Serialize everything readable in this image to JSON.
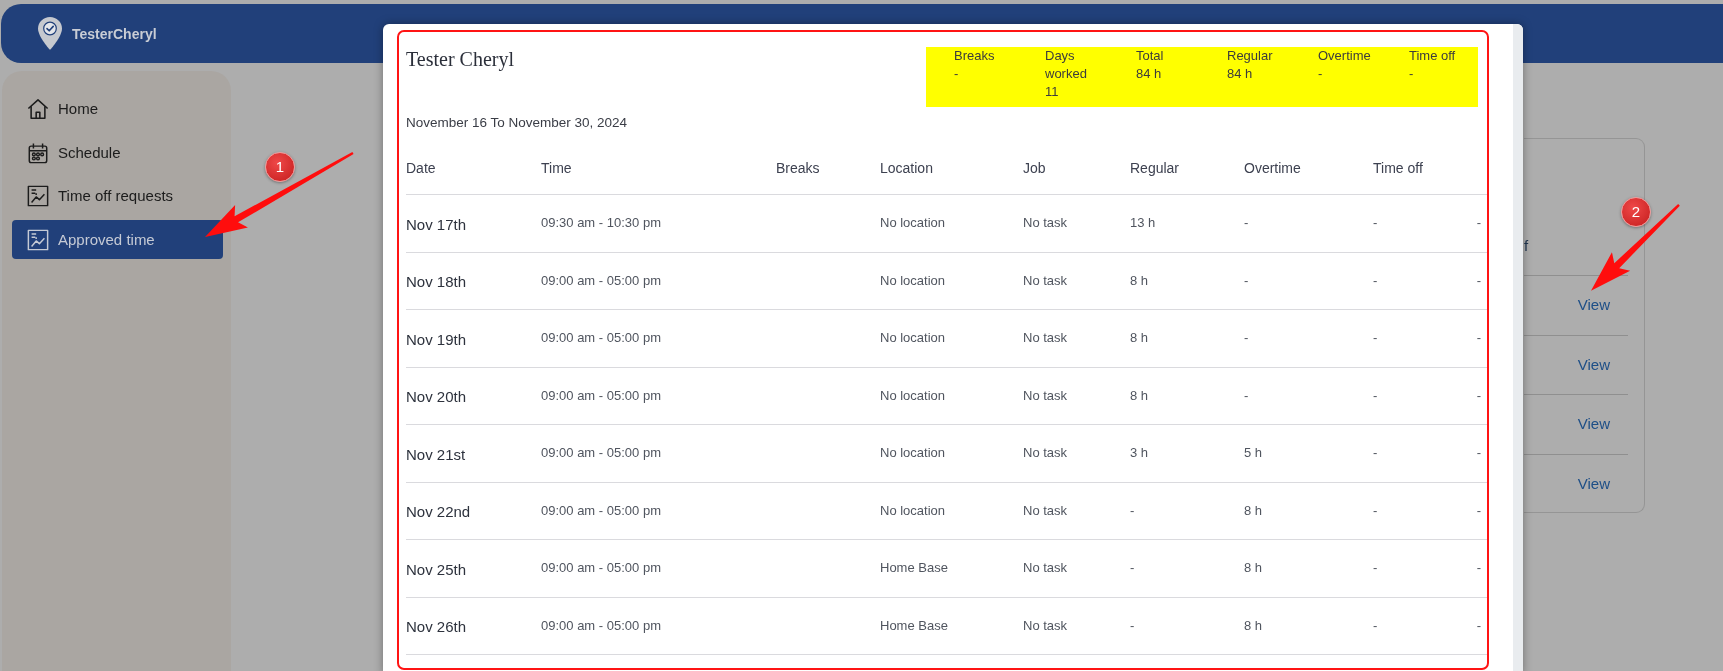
{
  "header": {
    "account_name": "TesterCheryl"
  },
  "sidebar": {
    "items": [
      {
        "label": "Home",
        "selected": false
      },
      {
        "label": "Schedule",
        "selected": false
      },
      {
        "label": "Time off requests",
        "selected": false
      },
      {
        "label": "Approved time",
        "selected": true
      }
    ]
  },
  "background_card": {
    "heading_fragment": "f",
    "rows": [
      {
        "link": "View"
      },
      {
        "link": "View"
      },
      {
        "link": "View"
      },
      {
        "link": "View"
      }
    ]
  },
  "modal": {
    "title": "Tester Cheryl",
    "summary": [
      {
        "label": "Breaks",
        "value": "-"
      },
      {
        "label": "Days worked",
        "value": "11"
      },
      {
        "label": "Total",
        "value": "84 h"
      },
      {
        "label": "Regular",
        "value": "84 h"
      },
      {
        "label": "Overtime",
        "value": "-"
      },
      {
        "label": "Time off",
        "value": "-"
      }
    ],
    "period": "November 16 To November 30, 2024",
    "table": {
      "columns": [
        "Date",
        "Time",
        "Breaks",
        "Location",
        "Job",
        "Regular",
        "Overtime",
        "Time off"
      ],
      "rows": [
        {
          "date": "Nov 17th",
          "time": "09:30 am - 10:30 pm",
          "location": "No location",
          "job": "No task",
          "regular": "13 h",
          "overtime": "-",
          "time_off": "-",
          "column_9": "-"
        },
        {
          "date": "Nov 18th",
          "time": "09:00 am - 05:00 pm",
          "location": "No location",
          "job": "No task",
          "regular": "8 h",
          "overtime": "-",
          "time_off": "-",
          "column_9": "-"
        },
        {
          "date": "Nov 19th",
          "time": "09:00 am - 05:00 pm",
          "location": "No location",
          "job": "No task",
          "regular": "8 h",
          "overtime": "-",
          "time_off": "-",
          "column_9": "-"
        },
        {
          "date": "Nov 20th",
          "time": "09:00 am - 05:00 pm",
          "location": "No location",
          "job": "No task",
          "regular": "8 h",
          "overtime": "-",
          "time_off": "-",
          "column_9": "-"
        },
        {
          "date": "Nov 21st",
          "time": "09:00 am - 05:00 pm",
          "location": "No location",
          "job": "No task",
          "regular": "3 h",
          "overtime": "5 h",
          "time_off": "-",
          "column_9": "-"
        },
        {
          "date": "Nov 22nd",
          "time": "09:00 am - 05:00 pm",
          "location": "No location",
          "job": "No task",
          "regular": "-",
          "overtime": "8 h",
          "time_off": "-",
          "column_9": "-"
        },
        {
          "date": "Nov 25th",
          "time": "09:00 am - 05:00 pm",
          "location": "Home Base",
          "job": "No task",
          "regular": "-",
          "overtime": "8 h",
          "time_off": "-",
          "column_9": "-"
        },
        {
          "date": "Nov 26th",
          "time": "09:00 am - 05:00 pm",
          "location": "Home Base",
          "job": "No task",
          "regular": "-",
          "overtime": "8 h",
          "time_off": "-",
          "column_9": "-"
        }
      ]
    }
  },
  "annotations": [
    {
      "number": "1"
    },
    {
      "number": "2"
    }
  ]
}
